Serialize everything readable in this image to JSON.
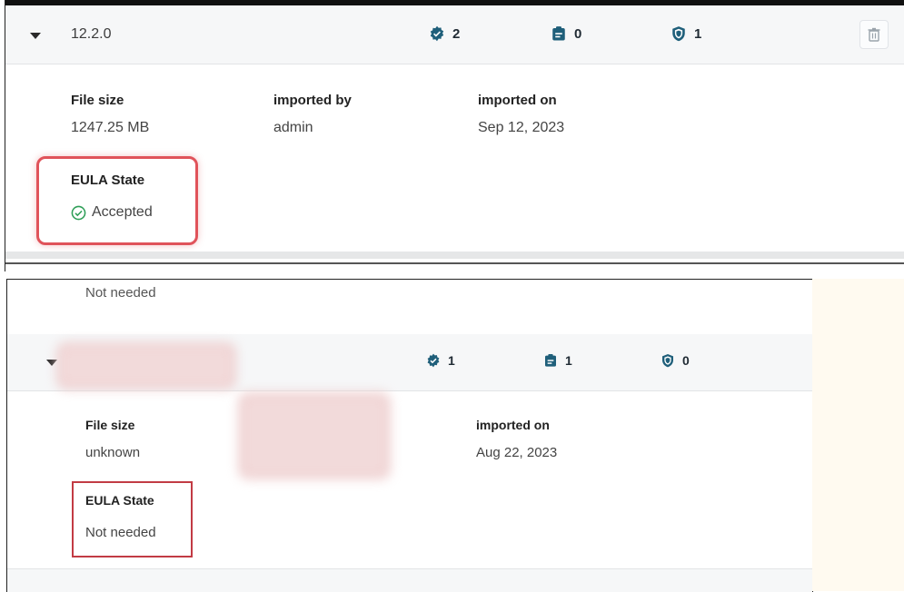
{
  "top_row": {
    "version": "12.2.0",
    "stats": {
      "components": "2",
      "tasks": "0",
      "security": "1"
    },
    "details": {
      "file_size_label": "File size",
      "file_size_value": "1247.25 MB",
      "imported_by_label": "imported by",
      "imported_by_value": "admin",
      "imported_on_label": "imported on",
      "imported_on_value": "Sep 12, 2023",
      "eula_label": "EULA State",
      "eula_value": "Accepted"
    }
  },
  "prev_row": {
    "eula_value": "Not needed"
  },
  "bottom_row": {
    "stats": {
      "components": "1",
      "tasks": "1",
      "security": "0"
    },
    "details": {
      "file_size_label": "File size",
      "file_size_value": "unknown",
      "imported_on_label": "imported on",
      "imported_on_value": "Aug 22, 2023",
      "eula_label": "EULA State",
      "eula_value": "Not needed"
    }
  },
  "colors": {
    "accent": "#1f5f7a",
    "highlight_top": "#e0535a",
    "highlight_bottom": "#c23b44",
    "success": "#2e9e57",
    "cream": "#fffaf0"
  },
  "icons": {
    "expand": "caret-down-icon",
    "components": "verified-badge-icon",
    "tasks": "clipboard-icon",
    "security": "shield-icon",
    "delete": "trash-icon",
    "eula_ok": "check-circle-icon"
  }
}
